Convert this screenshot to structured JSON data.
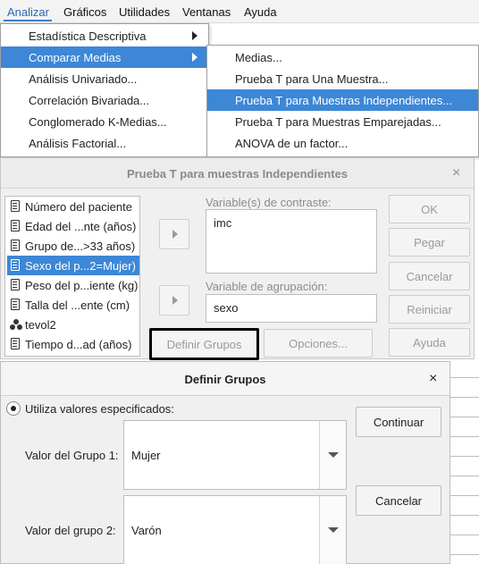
{
  "menubar": {
    "items": [
      "Analizar",
      "Gráficos",
      "Utilidades",
      "Ventanas",
      "Ayuda"
    ]
  },
  "analizar_menu": {
    "items": [
      "Estadística Descriptiva",
      "Comparar Medias",
      "Análisis Univariado...",
      "Correlación Bivariada...",
      "Conglomerado K-Medias...",
      "Análisis Factorial..."
    ]
  },
  "comparar_medias_menu": {
    "items": [
      "Medias...",
      "Prueba T para Una Muestra...",
      "Prueba T para Muestras Independientes...",
      "Prueba T para Muestras Emparejadas...",
      "ANOVA de un factor..."
    ]
  },
  "ttest_dialog": {
    "title": "Prueba T para muestras Independientes",
    "close": "×",
    "variables": [
      "Número del paciente",
      "Edad del ...nte (años)",
      "Grupo de...>33 años)",
      "Sexo del p...2=Mujer)",
      "Peso del p...iente (kg)",
      "Talla del ...ente (cm)",
      "tevol2",
      "Tiempo d...ad (años)"
    ],
    "test_vars_label": "Variable(s) de contraste:",
    "test_vars_value": "imc",
    "grouping_label": "Variable de agrupación:",
    "grouping_value": "sexo",
    "define_groups": "Definir Grupos",
    "options": "Opciones...",
    "ok": "OK",
    "paste": "Pegar",
    "cancel": "Cancelar",
    "reset": "Reiniciar",
    "help": "Ayuda"
  },
  "define_groups_dialog": {
    "title": "Definir Grupos",
    "close": "×",
    "radio_label": "Utiliza valores especificados:",
    "group1_label": "Valor del Grupo 1:",
    "group1_value": "Mujer",
    "group2_label": "Valor del grupo 2:",
    "group2_value": "Varón",
    "continue": "Continuar",
    "cancel": "Cancelar"
  }
}
